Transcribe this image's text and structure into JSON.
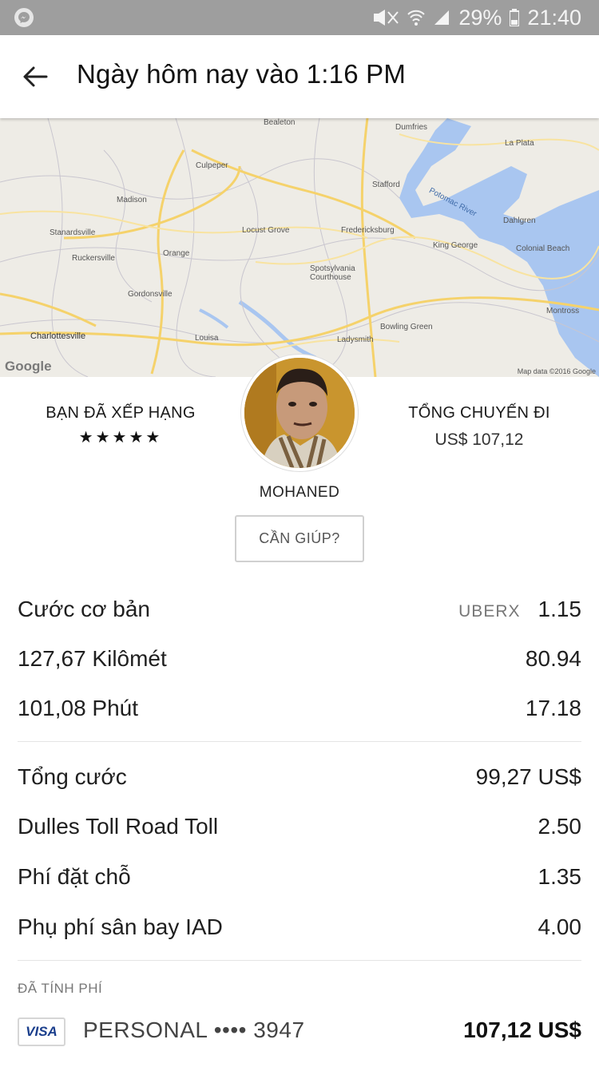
{
  "status_bar": {
    "battery": "29%",
    "time": "21:40"
  },
  "header": {
    "title": "Ngày hôm nay vào 1:16 PM"
  },
  "map": {
    "labels": [
      "Bealeton",
      "Dumfries",
      "La Plata",
      "Culpeper",
      "Stafford",
      "Madison",
      "Locust Grove",
      "Fredericksburg",
      "Dahlgren",
      "Stanardsville",
      "Ruckersville",
      "Orange",
      "King George",
      "Colonial Beach",
      "Spotsylvania Courthouse",
      "Gordonsville",
      "Bowling Green",
      "Montross",
      "Charlottesville",
      "Louisa",
      "Ladysmith",
      "Potomac River"
    ],
    "attribution": "Map data ©2016 Google",
    "logo": "Google"
  },
  "driver": {
    "rated_label": "BẠN ĐÃ XẾP HẠNG",
    "rating_stars": "★★★★★",
    "rating_value": 5,
    "name": "MOHANED",
    "trip_total_label": "TỔNG CHUYẾN ĐI",
    "trip_total_value": "US$ 107,12",
    "help_label": "CẦN GIÚP?"
  },
  "fare": {
    "base": {
      "label": "Cước cơ bản",
      "type": "UBERX",
      "amount": "1.15"
    },
    "distance": {
      "label": "127,67 Kilômét",
      "amount": "80.94"
    },
    "time": {
      "label": "101,08 Phút",
      "amount": "17.18"
    },
    "subtotal": {
      "label": "Tổng cước",
      "amount": "99,27 US$"
    },
    "toll": {
      "label": "Dulles Toll Road Toll",
      "amount": "2.50"
    },
    "booking": {
      "label": "Phí đặt chỗ",
      "amount": "1.35"
    },
    "airport": {
      "label": "Phụ phí sân bay IAD",
      "amount": "4.00"
    }
  },
  "payment": {
    "charged_label": "ĐÃ TÍNH PHÍ",
    "card_brand": "VISA",
    "card_label": "PERSONAL •••• 3947",
    "total": "107,12 US$"
  },
  "colors": {
    "status_bar": "#9e9e9e",
    "water": "#a9c6f0",
    "road": "#f5d26b",
    "visa": "#1a3e8c"
  },
  "icons": {
    "back": "arrow-left-icon",
    "messenger": "messenger-icon",
    "wifi": "wifi-icon",
    "signal": "signal-icon",
    "battery": "battery-icon",
    "mute": "mute-icon"
  }
}
